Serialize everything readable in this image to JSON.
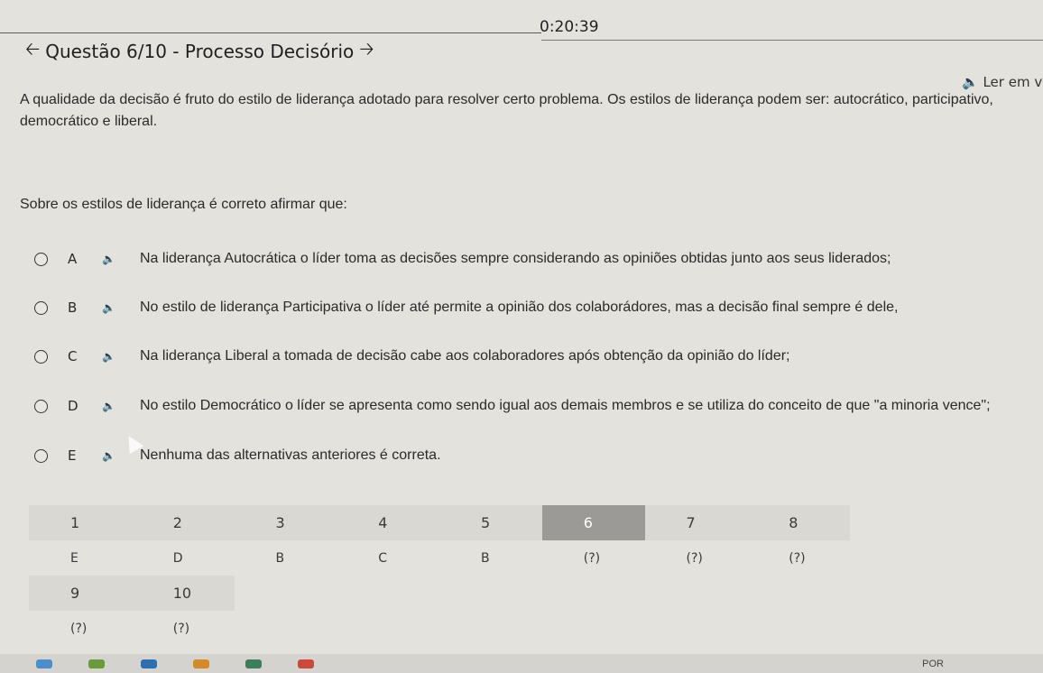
{
  "timer": "0:20:39",
  "header": {
    "title": "Questão 6/10 - Processo Decisório",
    "prev_icon": "arrow-left-icon",
    "next_icon": "arrow-right-icon"
  },
  "read_aloud": "Ler em v",
  "statement": "A qualidade da decisão é fruto do estilo de liderança adotado para resolver certo problema. Os estilos de liderança podem ser: autocrático, participativo, democrático e liberal.",
  "question": "Sobre os estilos de liderança é correto afirmar que:",
  "options": [
    {
      "letter": "A",
      "text": "Na liderança Autocrática o líder toma as decisões sempre considerando as opiniões obtidas junto aos seus liderados;"
    },
    {
      "letter": "B",
      "text": "No estilo de liderança Participativa o líder até permite a opinião dos colaborádores, mas a decisão final sempre é dele,"
    },
    {
      "letter": "C",
      "text": "Na liderança Liberal a tomada de decisão cabe aos colaboradores após obtenção da opinião do líder;"
    },
    {
      "letter": "D",
      "text": "No estilo Democrático o líder se apresenta como sendo igual aos demais membros e se utiliza do conceito de que \"a minoria vence\";"
    },
    {
      "letter": "E",
      "text": "Nenhuma das alternativas anteriores é correta."
    }
  ],
  "nav_grid": {
    "row1_numbers": [
      "1",
      "2",
      "3",
      "4",
      "5",
      "6",
      "7",
      "8"
    ],
    "row1_answers": [
      "E",
      "D",
      "B",
      "C",
      "B",
      "(?)",
      "(?)",
      "(?)"
    ],
    "row2_numbers": [
      "9",
      "10"
    ],
    "row2_answers": [
      "(?)",
      "(?)"
    ],
    "active": "6"
  },
  "taskbar": {
    "lang": "POR"
  },
  "colors": {
    "background": "#e3e2dd",
    "active_cell": "#9b9a97"
  }
}
